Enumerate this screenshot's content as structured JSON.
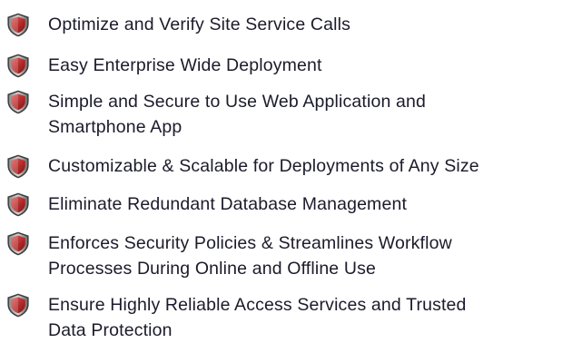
{
  "features": [
    {
      "icon": "shield-icon",
      "text": "Optimize and Verify Site Service Calls"
    },
    {
      "icon": "shield-icon",
      "text": "Easy Enterprise Wide Deployment"
    },
    {
      "icon": "shield-icon",
      "text": "Simple and Secure to Use Web Application and\nSmartphone App"
    },
    {
      "icon": "shield-icon",
      "text": "Customizable & Scalable for Deployments of Any Size"
    },
    {
      "icon": "shield-icon",
      "text": "Eliminate Redundant Database Management"
    },
    {
      "icon": "shield-icon",
      "text": "Enforces Security Policies & Streamlines Workflow\nProcesses During Online and Offline Use"
    },
    {
      "icon": "shield-icon",
      "text": "Ensure Highly Reliable Access Services and Trusted\nData Protection"
    }
  ],
  "colors": {
    "text": "#1b1b2b",
    "shield_outer": "#4a4a4a",
    "shield_inner": "#b32a2a"
  }
}
